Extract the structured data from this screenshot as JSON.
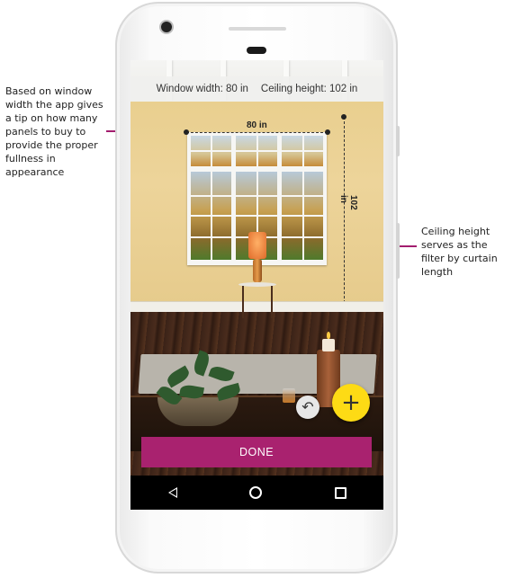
{
  "annotations": {
    "left": "Based on window width the app gives a tip on how many panels to buy to provide the proper fullness in appearance",
    "right": "Ceiling height serves as the filter by curtain length"
  },
  "measurements": {
    "window_width_label": "Window width: 80 in",
    "ceiling_height_label": "Ceiling height: 102 in",
    "width_dimension": "80 in",
    "height_dimension": "102 in"
  },
  "actions": {
    "undo_icon": "undo-icon",
    "add_icon": "plus-icon",
    "add_symbol": "+",
    "done_label": "DONE"
  },
  "nav": {
    "back_icon": "back-triangle-icon",
    "home_icon": "home-circle-icon",
    "recents_icon": "recents-square-icon"
  },
  "colors": {
    "accent": "#a9226f",
    "fab": "#fddb15",
    "arrow": "#a31d6e"
  }
}
